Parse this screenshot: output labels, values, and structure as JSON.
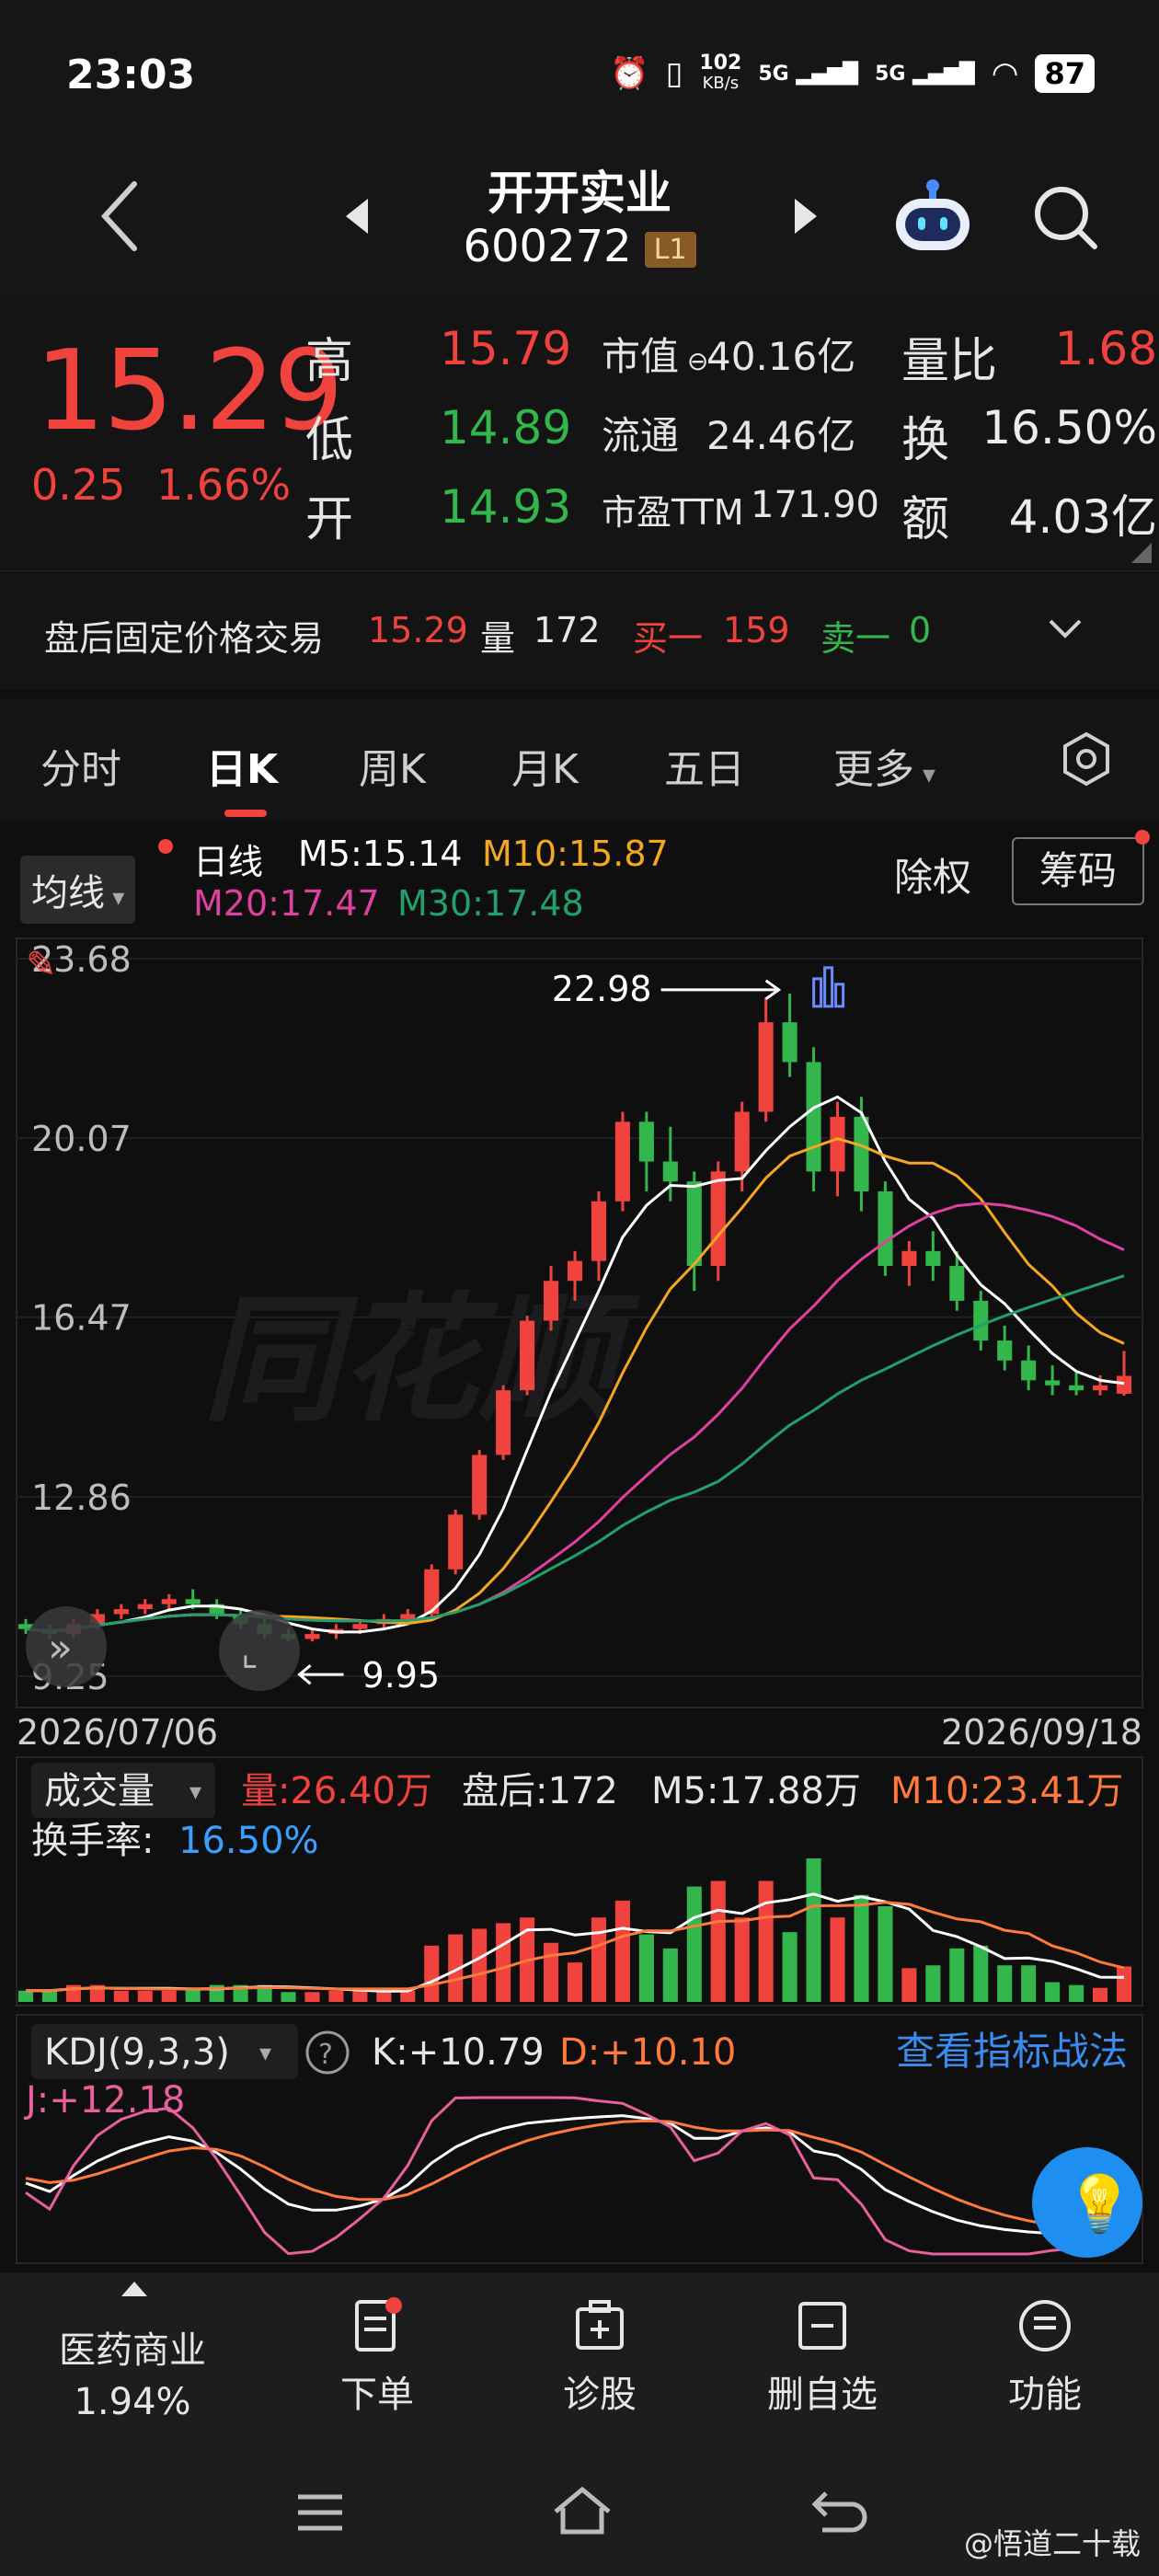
{
  "status": {
    "time": "23:03",
    "net_speed": "102",
    "net_speed_unit": "KB/s",
    "signal1": "5G",
    "signal2": "5G",
    "battery": "87"
  },
  "header": {
    "name": "开开实业",
    "code": "600272",
    "level": "L1"
  },
  "quote": {
    "price": "15.29",
    "change": "0.25",
    "change_pct": "1.66%",
    "high_label": "高",
    "high": "15.79",
    "low_label": "低",
    "low": "14.89",
    "open_label": "开",
    "open": "14.93",
    "mcap_label": "市值",
    "mcap": "40.16亿",
    "float_label": "流通",
    "float": "24.46亿",
    "pe_label": "市盈TTM",
    "pe": "171.90",
    "vr_label": "量比",
    "vr": "1.68",
    "turn_label": "换",
    "turn": "16.50%",
    "amt_label": "额",
    "amt": "4.03亿"
  },
  "afterhours": {
    "label": "盘后固定价格交易",
    "price": "15.29",
    "vol_label": "量",
    "vol": "172",
    "bid_label": "买一",
    "bid": "159",
    "ask_label": "卖一",
    "ask": "0"
  },
  "tabs": {
    "t1": "分时",
    "t2": "日K",
    "t3": "周K",
    "t4": "月K",
    "t5": "五日",
    "t6": "更多"
  },
  "ma": {
    "btn": "均线",
    "line": "日线",
    "m5": "M5:15.14",
    "m10": "M10:15.87",
    "m20": "M20:17.47",
    "m30": "M30:17.48",
    "fq": "除权",
    "chip": "筹码"
  },
  "chart_data": {
    "type": "candlestick",
    "y_ticks": [
      "23.68",
      "20.07",
      "16.47",
      "12.86",
      "9.25"
    ],
    "ylim": [
      9.25,
      23.68
    ],
    "x_start": "2026/07/06",
    "x_end": "2026/09/18",
    "high_mark": "22.98",
    "low_mark": "9.95",
    "colors": {
      "up": "#f0433d",
      "down": "#33b64b",
      "m5": "#ffffff",
      "m10": "#f5a623",
      "m20": "#e040a0",
      "m30": "#22a06b"
    },
    "candles": [
      [
        10.3,
        10.4,
        10.1,
        10.2
      ],
      [
        10.2,
        10.3,
        10.0,
        10.1
      ],
      [
        10.1,
        10.4,
        10.0,
        10.3
      ],
      [
        10.3,
        10.6,
        10.2,
        10.5
      ],
      [
        10.5,
        10.7,
        10.4,
        10.6
      ],
      [
        10.6,
        10.8,
        10.5,
        10.7
      ],
      [
        10.7,
        10.9,
        10.6,
        10.8
      ],
      [
        10.8,
        11.0,
        10.6,
        10.7
      ],
      [
        10.7,
        10.8,
        10.4,
        10.5
      ],
      [
        10.5,
        10.6,
        10.2,
        10.3
      ],
      [
        10.3,
        10.4,
        10.0,
        10.1
      ],
      [
        10.1,
        10.2,
        9.95,
        10.0
      ],
      [
        10.0,
        10.2,
        9.95,
        10.1
      ],
      [
        10.1,
        10.3,
        10.0,
        10.2
      ],
      [
        10.2,
        10.4,
        10.1,
        10.3
      ],
      [
        10.3,
        10.5,
        10.2,
        10.4
      ],
      [
        10.4,
        10.6,
        10.3,
        10.5
      ],
      [
        10.5,
        11.5,
        10.4,
        11.4
      ],
      [
        11.4,
        12.6,
        11.3,
        12.5
      ],
      [
        12.5,
        13.8,
        12.4,
        13.7
      ],
      [
        13.7,
        15.1,
        13.6,
        15.0
      ],
      [
        15.0,
        16.5,
        14.9,
        16.4
      ],
      [
        16.4,
        17.5,
        16.2,
        17.2
      ],
      [
        17.2,
        17.8,
        16.8,
        17.6
      ],
      [
        17.6,
        19.0,
        17.2,
        18.8
      ],
      [
        18.8,
        20.6,
        18.6,
        20.4
      ],
      [
        20.4,
        20.6,
        19.0,
        19.6
      ],
      [
        19.6,
        20.3,
        18.8,
        19.2
      ],
      [
        19.2,
        19.4,
        17.0,
        17.5
      ],
      [
        17.5,
        19.6,
        17.2,
        19.4
      ],
      [
        19.4,
        20.8,
        19.0,
        20.6
      ],
      [
        20.6,
        22.9,
        20.4,
        22.4
      ],
      [
        22.4,
        22.98,
        21.3,
        21.6
      ],
      [
        21.6,
        21.9,
        19.0,
        19.4
      ],
      [
        19.4,
        20.8,
        18.9,
        20.5
      ],
      [
        20.5,
        20.9,
        18.6,
        19.0
      ],
      [
        19.0,
        19.2,
        17.3,
        17.5
      ],
      [
        17.5,
        18.0,
        17.1,
        17.8
      ],
      [
        17.8,
        18.2,
        17.2,
        17.5
      ],
      [
        17.5,
        17.8,
        16.6,
        16.8
      ],
      [
        16.8,
        17.0,
        15.8,
        16.0
      ],
      [
        16.0,
        16.3,
        15.4,
        15.6
      ],
      [
        15.6,
        15.9,
        15.0,
        15.2
      ],
      [
        15.2,
        15.5,
        14.9,
        15.1
      ],
      [
        15.1,
        15.4,
        14.9,
        15.0
      ],
      [
        15.0,
        15.3,
        14.9,
        15.1
      ],
      [
        14.93,
        15.79,
        14.89,
        15.29
      ]
    ],
    "volume": {
      "label": "成交量",
      "vol": "量:26.40万",
      "after": "盘后:172",
      "m5": "M5:17.88万",
      "m10": "M10:23.41万",
      "turn": "换手率:",
      "turn_val": "16.50%"
    },
    "kdj": {
      "label": "KDJ(9,3,3)",
      "k": "K:+10.79",
      "d": "D:+10.10",
      "j": "J:+12.18",
      "link": "查看指标战法"
    }
  },
  "bottom_nav": {
    "sector": "医药商业",
    "sector_pct": "1.94%",
    "order": "下单",
    "diag": "诊股",
    "del": "删自选",
    "func": "功能"
  },
  "watermark": "@悟道二十载"
}
